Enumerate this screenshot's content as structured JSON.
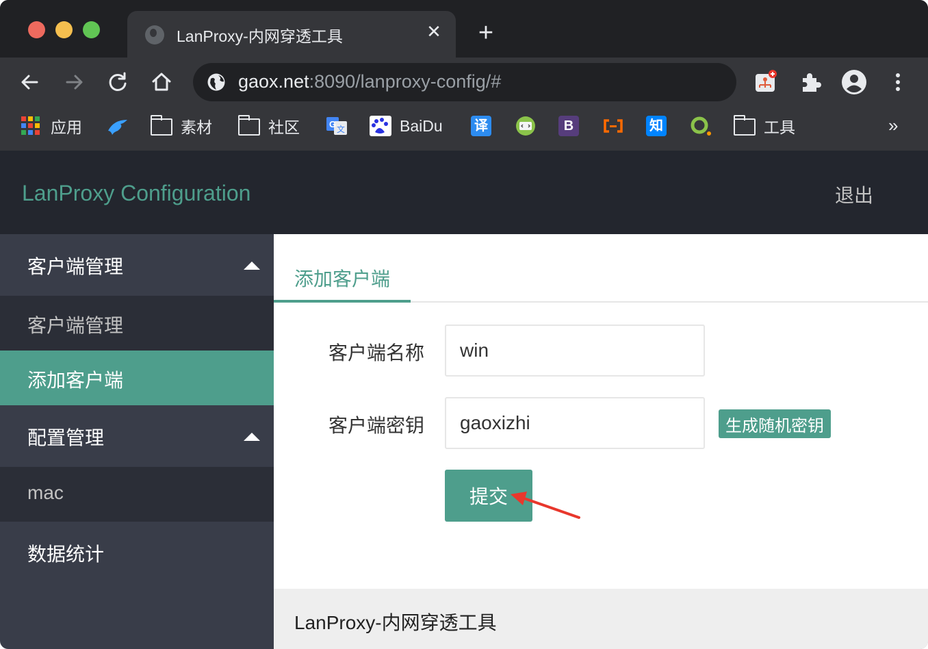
{
  "browser": {
    "tab_title": "LanProxy-内网穿透工具",
    "tab_close": "✕",
    "new_tab": "+",
    "url_host": "gaox.net",
    "url_rest": ":8090/lanproxy-config/#",
    "bookmarks": [
      {
        "label": "应用",
        "icon": "apps-grid-icon"
      },
      {
        "label": "",
        "icon": "bird-icon"
      },
      {
        "label": "素材",
        "icon": "folder-icon"
      },
      {
        "label": "社区",
        "icon": "folder-icon"
      },
      {
        "label": "",
        "icon": "google-translate-icon"
      },
      {
        "label": "BaiDu",
        "icon": "baidu-icon"
      },
      {
        "label": "译",
        "icon": "translate-icon"
      },
      {
        "label": "",
        "icon": "code-icon"
      },
      {
        "label": "B",
        "icon": "bootstrap-icon"
      },
      {
        "label": "",
        "icon": "aliyun-icon"
      },
      {
        "label": "知",
        "icon": "zhihu-icon"
      },
      {
        "label": "",
        "icon": "circle-logo-icon"
      },
      {
        "label": "工具",
        "icon": "folder-icon"
      }
    ],
    "bookmarks_more": "»"
  },
  "app": {
    "logo": "LanProxy Configuration",
    "logout": "退出",
    "nav": {
      "group1": "客户端管理",
      "item1": "客户端管理",
      "item2": "添加客户端",
      "group2": "配置管理",
      "item3": "mac",
      "group3": "数据统计"
    },
    "tab": "添加客户端",
    "form": {
      "name_label": "客户端名称",
      "name_value": "win",
      "key_label": "客户端密钥",
      "key_value": "gaoxizhi",
      "generate_button": "生成随机密钥",
      "submit_button": "提交"
    },
    "footer": "LanProxy-内网穿透工具"
  },
  "colors": {
    "accent": "#4e9e8c",
    "header_bg": "#23262e",
    "sidebar_bg": "#393d49",
    "sidebar_item_bg": "#2b2e37",
    "annotation_arrow": "#e8372c"
  }
}
